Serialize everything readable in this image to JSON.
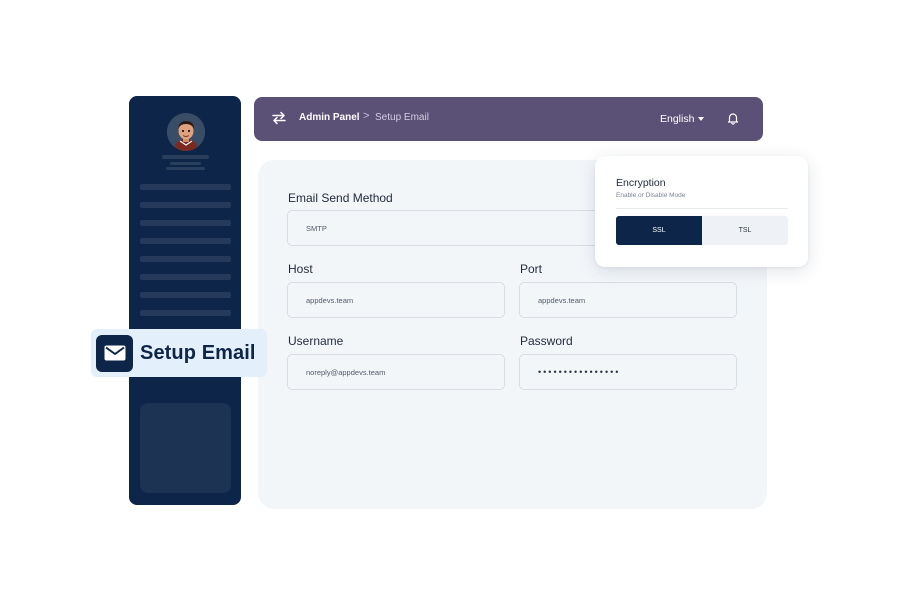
{
  "sidebar": {
    "avatar": "user-avatar"
  },
  "badge": {
    "icon": "mail-icon",
    "label": "Setup Email"
  },
  "header": {
    "icon": "swap-icon",
    "breadcrumb_root": "Admin Panel",
    "breadcrumb_separator": ">",
    "breadcrumb_current": "Setup Email",
    "language": "English",
    "language_icon": "chevron-down-icon",
    "notification_icon": "bell-icon"
  },
  "form": {
    "email_send_method": {
      "label": "Email Send Method",
      "value": "SMTP"
    },
    "host": {
      "label": "Host",
      "value": "appdevs.team"
    },
    "port": {
      "label": "Port",
      "value": "appdevs.team"
    },
    "username": {
      "label": "Username",
      "value": "noreply@appdevs.team"
    },
    "password": {
      "label": "Password",
      "value": "••••••••••••••••"
    }
  },
  "encryption": {
    "title": "Encryption",
    "subtitle": "Enable or Disable Mode",
    "options": [
      "SSL",
      "TSL"
    ],
    "selected": "SSL"
  },
  "colors": {
    "sidebar_bg": "#0d2548",
    "header_bg": "#5b5076",
    "panel_bg": "#f3f6f9",
    "badge_bg": "#e3f0fb",
    "accent": "#0d2548"
  }
}
